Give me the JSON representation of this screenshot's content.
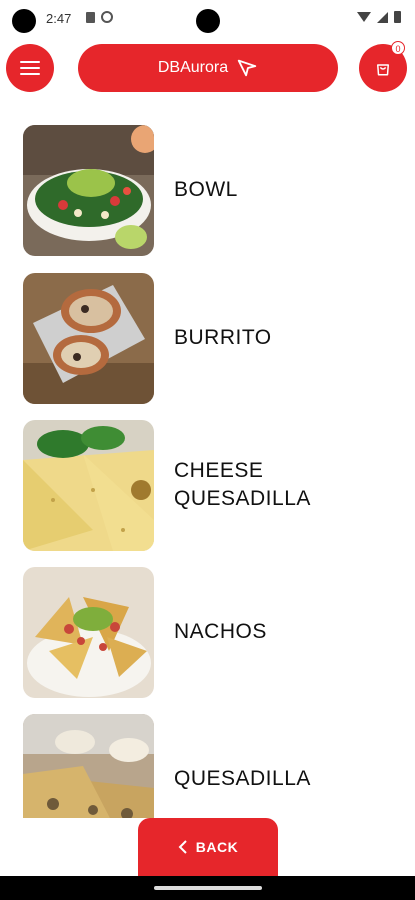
{
  "status": {
    "time": "2:47"
  },
  "header": {
    "brand": "DBAurora",
    "cart_count": "0"
  },
  "colors": {
    "accent": "#e6262b"
  },
  "menu": {
    "items": [
      {
        "label": "BOWL"
      },
      {
        "label": "BURRITO"
      },
      {
        "label": "CHEESE QUESADILLA"
      },
      {
        "label": "NACHOS"
      },
      {
        "label": "QUESADILLA"
      }
    ]
  },
  "footer": {
    "back_label": "BACK"
  }
}
